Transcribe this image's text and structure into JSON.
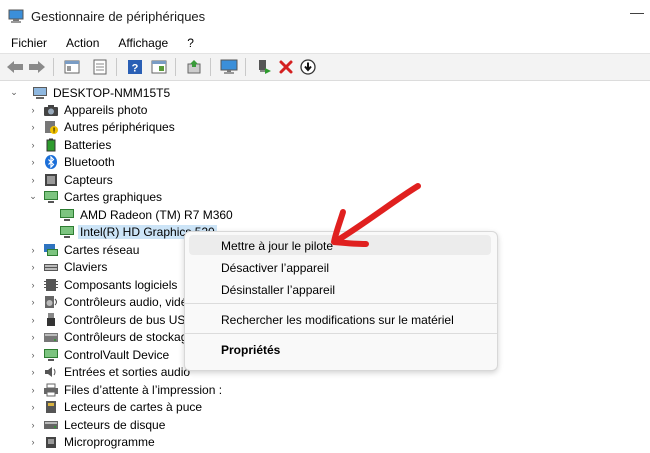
{
  "window": {
    "title": "Gestionnaire de périphériques",
    "minimize_glyph": "—"
  },
  "menu": {
    "items": [
      "Fichier",
      "Action",
      "Affichage",
      "?"
    ]
  },
  "toolbar": {
    "buttons": [
      "back-icon",
      "forward-icon",
      "properties-icon",
      "list-icon",
      "help-icon",
      "view-icon",
      "update-driver-icon",
      "monitor-icon",
      "enable-icon",
      "uninstall-icon",
      "download-icon"
    ]
  },
  "tree": {
    "root": "DESKTOP-NMM15T5",
    "items": [
      {
        "label": "Appareils photo",
        "icon": "camera-icon"
      },
      {
        "label": "Autres périphériques",
        "icon": "unknown-device-icon"
      },
      {
        "label": "Batteries",
        "icon": "battery-icon"
      },
      {
        "label": "Bluetooth",
        "icon": "bluetooth-icon"
      },
      {
        "label": "Capteurs",
        "icon": "sensor-icon"
      },
      {
        "label": "Cartes graphiques",
        "icon": "display-adapter-icon",
        "expanded": true,
        "children": [
          {
            "label": "AMD Radeon (TM) R7 M360",
            "icon": "display-adapter-icon"
          },
          {
            "label": "Intel(R) HD Graphics 520",
            "icon": "display-adapter-icon",
            "selected": true
          }
        ]
      },
      {
        "label": "Cartes réseau",
        "icon": "network-icon"
      },
      {
        "label": "Claviers",
        "icon": "keyboard-icon"
      },
      {
        "label": "Composants logiciels",
        "icon": "software-icon"
      },
      {
        "label": "Contrôleurs audio, vidéo et jeu",
        "icon": "audio-icon"
      },
      {
        "label": "Contrôleurs de bus USB",
        "icon": "usb-icon"
      },
      {
        "label": "Contrôleurs de stockage",
        "icon": "storage-icon"
      },
      {
        "label": "ControlVault Device",
        "icon": "security-device-icon"
      },
      {
        "label": "Entrées et sorties audio",
        "icon": "speaker-icon"
      },
      {
        "label": "Files d’attente à l’impression :",
        "icon": "printer-icon"
      },
      {
        "label": "Lecteurs de cartes à puce",
        "icon": "smartcard-icon"
      },
      {
        "label": "Lecteurs de disque",
        "icon": "disk-icon"
      },
      {
        "label": "Microprogramme",
        "icon": "firmware-icon"
      }
    ]
  },
  "context_menu": {
    "update": "Mettre à jour le pilote",
    "disable": "Désactiver l’appareil",
    "uninstall": "Désinstaller l’appareil",
    "scan": "Rechercher les modifications sur le matériel",
    "properties": "Propriétés"
  },
  "colors": {
    "annotation_arrow": "#e0201f",
    "selection": "#cce4f7",
    "toolbar_bg": "#f3f3f3"
  }
}
